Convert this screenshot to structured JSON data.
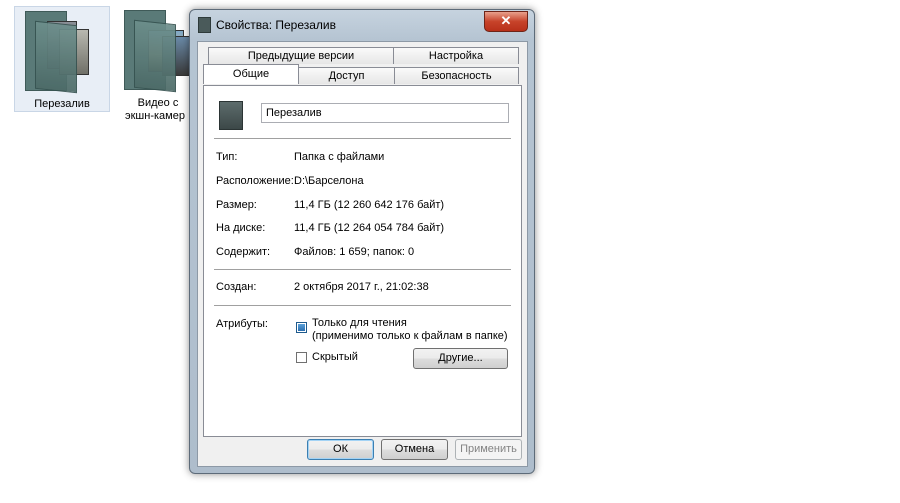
{
  "desktop": {
    "items": [
      {
        "label": "Перезалив"
      },
      {
        "label_line1": "Видео с",
        "label_line2": "экшн-камер"
      }
    ]
  },
  "dialog": {
    "title": "Свойства: Перезалив",
    "close_glyph": "✕",
    "tabs": {
      "previous_versions": "Предыдущие версии",
      "customize": "Настройка",
      "general": "Общие",
      "sharing": "Доступ",
      "security": "Безопасность"
    },
    "general": {
      "name_value": "Перезалив",
      "rows": {
        "type": {
          "label": "Тип:",
          "value": "Папка с файлами"
        },
        "location": {
          "label": "Расположение:",
          "value": "D:\\Барселона"
        },
        "size": {
          "label": "Размер:",
          "value": "11,4 ГБ (12 260 642 176 байт)"
        },
        "size_on_disk": {
          "label": "На диске:",
          "value": "11,4 ГБ (12 264 054 784 байт)"
        },
        "contains": {
          "label": "Содержит:",
          "value": "Файлов: 1 659; папок: 0"
        },
        "created": {
          "label": "Создан:",
          "value": "2 октября 2017 г., 21:02:38"
        }
      },
      "attributes": {
        "label": "Атрибуты:",
        "readonly_label": "Только для чтения",
        "readonly_note": "(применимо только к файлам в папке)",
        "hidden_label": "Скрытый",
        "advanced_button": "Другие..."
      }
    },
    "buttons": {
      "ok": "ОК",
      "cancel": "Отмена",
      "apply": "Применить"
    }
  }
}
